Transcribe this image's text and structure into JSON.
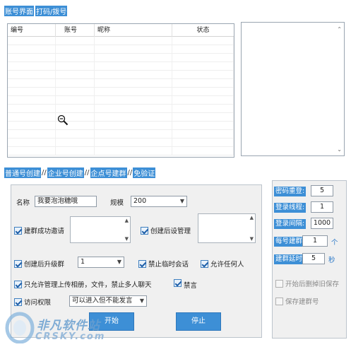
{
  "top_tabs": [
    {
      "label": "账号界面",
      "selected": true
    },
    {
      "label": "打码/拨号",
      "selected": true
    }
  ],
  "account_table": {
    "columns": [
      "编号",
      "账号",
      "昵称",
      "状态"
    ]
  },
  "mode_tabs": [
    {
      "label": "普通号创建",
      "selected": true
    },
    {
      "label": "//",
      "selected": false
    },
    {
      "label": "企业号创建",
      "selected": true
    },
    {
      "label": "//",
      "selected": false
    },
    {
      "label": "企点号建群",
      "selected": true
    },
    {
      "label": "//",
      "selected": false
    },
    {
      "label": "免验证",
      "selected": true
    }
  ],
  "form": {
    "name_label": "名称",
    "name_value": "我要泡泡糖哦",
    "scale_label": "规模",
    "scale_value": "200",
    "invite_label": "建群成功邀请",
    "invite_checked": true,
    "admin_label": "创建后设管理",
    "admin_checked": true,
    "upgrade_label": "创建后升级群",
    "upgrade_checked": true,
    "upgrade_value": "1",
    "no_temp_chat_label": "禁止临时会话",
    "no_temp_chat_checked": true,
    "allow_anyone_label": "允许任何人",
    "allow_anyone_checked": true,
    "admin_upload_label": "只允许管理上传相册，文件，禁止多人聊天",
    "admin_upload_checked": true,
    "mute_label": "禁言",
    "mute_checked": true,
    "access_label": "访问权限",
    "access_checked": true,
    "access_value": "可以进入但不能发言",
    "start_button": "开始",
    "stop_button": "停止"
  },
  "right_panel": {
    "password_label": "密码重登:",
    "password_value": "5",
    "threads_label": "登录线程:",
    "threads_value": "1",
    "interval_label": "登录间隔:",
    "interval_value": "1000",
    "per_account_label": "每号建群",
    "per_account_value": "1",
    "per_account_unit": "个",
    "delay_label": "建群延时",
    "delay_value": "5",
    "delay_unit": "秒",
    "delete_old_label": "开始后删掉旧保存",
    "delete_old_checked": false,
    "save_label": "保存建群号",
    "save_checked": false
  },
  "watermark": {
    "text": "非凡软件站",
    "sub": "CRSKY.com"
  },
  "icons": {
    "zoom_cursor": "zoom-out-icon",
    "scroll_up": "chevron-up-icon",
    "scroll_down": "chevron-down-icon",
    "dropdown": "chevron-down-icon"
  },
  "colors": {
    "accent": "#3d8fd6",
    "unit_text": "#2a78c8",
    "panel_bg": "#f0f0f0"
  }
}
